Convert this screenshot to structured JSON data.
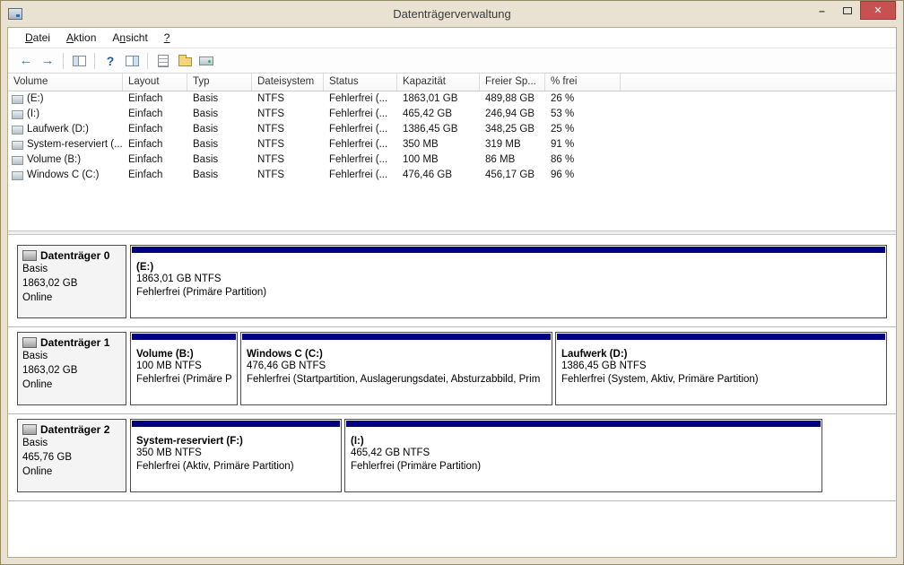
{
  "window": {
    "title": "Datenträgerverwaltung"
  },
  "icons": {
    "minimize": "–",
    "close": "✕",
    "back": "←",
    "forward": "→",
    "help": "?"
  },
  "menu": {
    "items": [
      {
        "pre": "",
        "accel": "D",
        "post": "atei"
      },
      {
        "pre": "",
        "accel": "A",
        "post": "ktion"
      },
      {
        "pre": "A",
        "accel": "n",
        "post": "sicht"
      },
      {
        "pre": "",
        "accel": "?",
        "post": ""
      }
    ]
  },
  "volume_list": {
    "columns": {
      "volume": "Volume",
      "layout": "Layout",
      "typ": "Typ",
      "fs": "Dateisystem",
      "status": "Status",
      "capacity": "Kapazität",
      "free": "Freier Sp...",
      "pct": "% frei"
    },
    "rows": [
      {
        "volume": "(E:)",
        "layout": "Einfach",
        "typ": "Basis",
        "fs": "NTFS",
        "status": "Fehlerfrei (...",
        "capacity": "1863,01 GB",
        "free": "489,88 GB",
        "pct": "26 %"
      },
      {
        "volume": "(I:)",
        "layout": "Einfach",
        "typ": "Basis",
        "fs": "NTFS",
        "status": "Fehlerfrei (...",
        "capacity": "465,42 GB",
        "free": "246,94 GB",
        "pct": "53 %"
      },
      {
        "volume": "Laufwerk (D:)",
        "layout": "Einfach",
        "typ": "Basis",
        "fs": "NTFS",
        "status": "Fehlerfrei (...",
        "capacity": "1386,45 GB",
        "free": "348,25 GB",
        "pct": "25 %"
      },
      {
        "volume": "System-reserviert (...",
        "layout": "Einfach",
        "typ": "Basis",
        "fs": "NTFS",
        "status": "Fehlerfrei (...",
        "capacity": "350 MB",
        "free": "319 MB",
        "pct": "91 %"
      },
      {
        "volume": "Volume (B:)",
        "layout": "Einfach",
        "typ": "Basis",
        "fs": "NTFS",
        "status": "Fehlerfrei (...",
        "capacity": "100 MB",
        "free": "86 MB",
        "pct": "86 %"
      },
      {
        "volume": "Windows C (C:)",
        "layout": "Einfach",
        "typ": "Basis",
        "fs": "NTFS",
        "status": "Fehlerfrei (...",
        "capacity": "476,46 GB",
        "free": "456,17 GB",
        "pct": "96 %"
      }
    ]
  },
  "disks": [
    {
      "name": "Datenträger 0",
      "type": "Basis",
      "size": "1863,02 GB",
      "status": "Online",
      "partitions": [
        {
          "label": "(E:)",
          "size": "1863,01 GB NTFS",
          "status": "Fehlerfrei (Primäre Partition)"
        }
      ]
    },
    {
      "name": "Datenträger 1",
      "type": "Basis",
      "size": "1863,02 GB",
      "status": "Online",
      "partitions": [
        {
          "label": "Volume  (B:)",
          "size": "100 MB NTFS",
          "status": "Fehlerfrei (Primäre P"
        },
        {
          "label": "Windows C  (C:)",
          "size": "476,46 GB NTFS",
          "status": "Fehlerfrei (Startpartition, Auslagerungsdatei, Absturzabbild, Prim"
        },
        {
          "label": "Laufwerk  (D:)",
          "size": "1386,45 GB NTFS",
          "status": "Fehlerfrei (System, Aktiv, Primäre Partition)"
        }
      ]
    },
    {
      "name": "Datenträger 2",
      "type": "Basis",
      "size": "465,76 GB",
      "status": "Online",
      "partitions": [
        {
          "label": "System-reserviert  (F:)",
          "size": "350 MB NTFS",
          "status": "Fehlerfrei (Aktiv, Primäre Partition)"
        },
        {
          "label": "(I:)",
          "size": "465,42 GB NTFS",
          "status": "Fehlerfrei (Primäre Partition)"
        }
      ]
    }
  ],
  "colors": {
    "primary_partition": "#000080",
    "titlebar": "#e9e2d2",
    "close_button": "#c75050"
  }
}
